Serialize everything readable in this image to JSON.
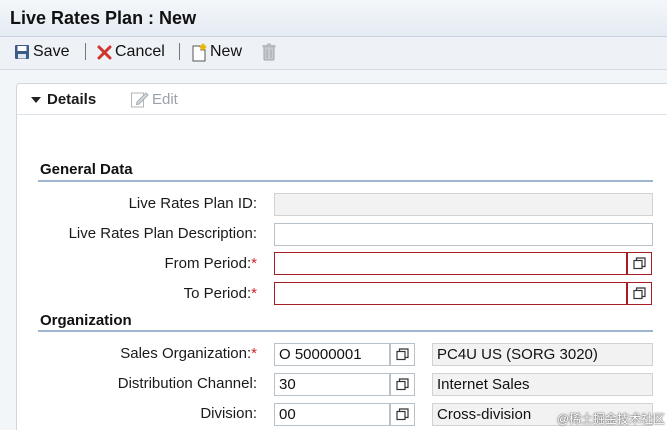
{
  "window": {
    "title": "Live Rates Plan : New"
  },
  "toolbar": {
    "save_label": "Save",
    "cancel_label": "Cancel",
    "new_label": "New"
  },
  "tabs": {
    "details_label": "Details",
    "edit_label": "Edit"
  },
  "general": {
    "section_title": "General Data",
    "plan_id_label": "Live Rates Plan ID:",
    "plan_id_value": "",
    "description_label": "Live Rates Plan Description:",
    "description_value": "",
    "from_period_label": "From Period:",
    "from_period_value": "",
    "to_period_label": "To Period:",
    "to_period_value": "",
    "required_marker": "*"
  },
  "organization": {
    "section_title": "Organization",
    "sales_org_label": "Sales Organization:",
    "sales_org_value": "O 50000001",
    "sales_org_desc": "PC4U US (SORG 3020)",
    "dist_channel_label": "Distribution Channel:",
    "dist_channel_value": "30",
    "dist_channel_desc": "Internet Sales",
    "division_label": "Division:",
    "division_value": "00",
    "division_desc": "Cross-division"
  },
  "watermark": "@稀土掘金技术社区",
  "colors": {
    "required": "#d2232a",
    "error_border": "#a61d24",
    "section_line": "#9cb6cf",
    "cancel_icon": "#d0342c"
  }
}
